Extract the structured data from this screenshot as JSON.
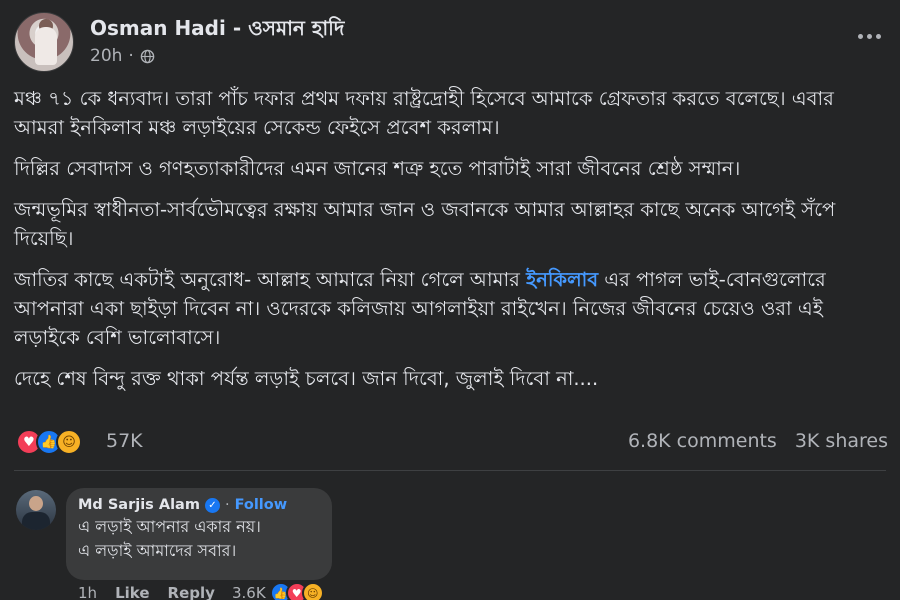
{
  "post": {
    "author": "Osman Hadi - ওসমান হাদি",
    "time": "20h",
    "paragraphs": [
      "মঞ্চ ৭১ কে ধন্যবাদ। তারা পাঁচ দফার প্রথম দফায় রাষ্ট্রদ্রোহী হিসেবে আমাকে গ্রেফতার করতে বলেছে। এবার আমরা ইনকিলাব মঞ্চ লড়াইয়ের সেকেন্ড ফেইসে প্রবেশ করলাম।",
      "দিল্লির সেবাদাস ও গণহত্যাকারীদের এমন জানের শত্রু হতে পারাটাই সারা জীবনের শ্রেষ্ঠ সম্মান।",
      "জন্মভূমির স্বাধীনতা-সার্বভৌমত্বের রক্ষায় আমার জান ও জবানকে আমার আল্লাহর কাছে অনেক আগেই সঁপে দিয়েছি।",
      "দেহে শেষ বিন্দু রক্ত থাকা পর্যন্ত লড়াই চলবে। জান দিবো, জুলাই দিবো না...."
    ],
    "p4_before": "জাতির কাছে একটাই অনুরোধ- আল্লাহ আমারে নিয়া গেলে আমার ",
    "p4_tag": "ইনকিলাব",
    "p4_after": " এর পাগল ভাই-বোনগুলোরে আপনারা একা ছাইড়া দিবেন না। ওদেরকে কলিজায় আগলাইয়া রাইখেন। নিজের জীবনের চেয়েও ওরা এই লড়াইকে বেশি ভালোবাসে।",
    "reaction_count": "57K",
    "comments_count": "6.8K comments",
    "shares_count": "3K shares"
  },
  "comment": {
    "name": "Md Sarjis Alam",
    "follow": "Follow",
    "dot": "·",
    "lines": [
      "এ লড়াই আপনার একার নয়।",
      "এ লড়াই আমাদের সবার।"
    ],
    "time": "1h",
    "like": "Like",
    "reply": "Reply",
    "reaction_count": "3.6K"
  },
  "icons": {
    "globe": "globe-icon",
    "more": "more-icon",
    "love": "love-reaction-icon",
    "like": "like-reaction-icon",
    "care": "care-reaction-icon",
    "verified": "verified-badge-icon"
  },
  "colors": {
    "background": "#242526",
    "text": "#e4e6eb",
    "muted": "#b0b3b8",
    "link": "#4599ff",
    "like_blue": "#1877f2",
    "love_red": "#f33e58"
  }
}
